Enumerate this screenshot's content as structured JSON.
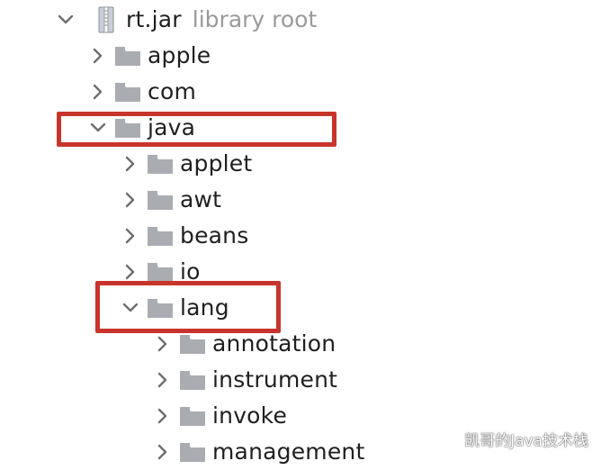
{
  "root": {
    "name": "rt.jar",
    "hint": "library root",
    "icon": "jar-archive-icon"
  },
  "items": {
    "apple": "apple",
    "com": "com",
    "java": "java",
    "applet": "applet",
    "awt": "awt",
    "beans": "beans",
    "io": "io",
    "lang": "lang",
    "annotation": "annotation",
    "instrument": "instrument",
    "invoke": "invoke",
    "management": "management"
  },
  "watermark": "凯哥的Java技术栈",
  "colors": {
    "highlight": "#c8342b",
    "folder": "#a9adb2",
    "chevron": "#6e6e6e",
    "text": "#1f1f1f",
    "muted": "#9a9a9a"
  }
}
